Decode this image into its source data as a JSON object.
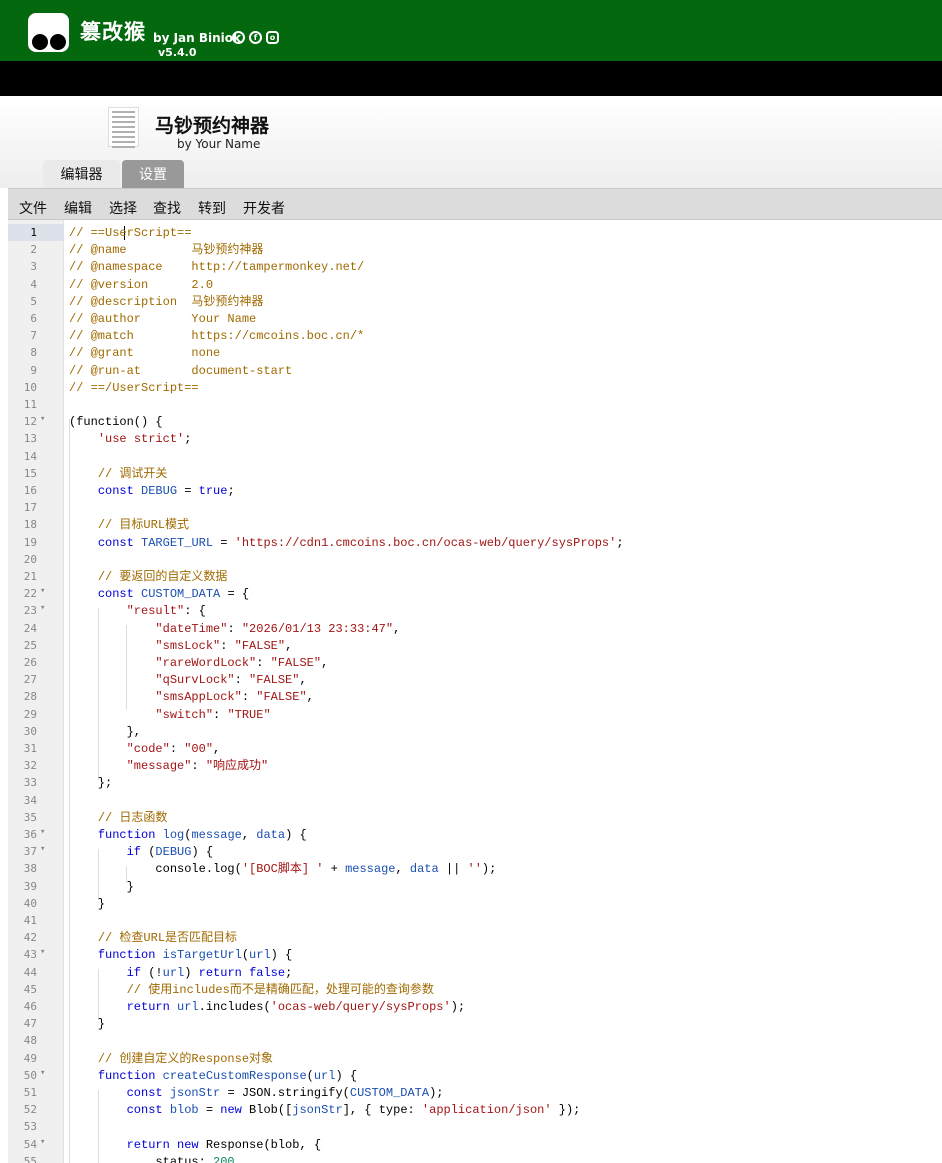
{
  "app": {
    "name": "篡改猴",
    "by": "by Jan Biniok",
    "version": "v5.4.0",
    "social_icons": [
      "github-icon",
      "facebook-icon",
      "instagram-icon"
    ],
    "brand_color": "#04680f"
  },
  "script": {
    "title": "马钞预约神器",
    "author": "by Your Name"
  },
  "tabs": [
    {
      "label": "编辑器",
      "active": true
    },
    {
      "label": "设置",
      "active": false
    }
  ],
  "menu": [
    "文件",
    "编辑",
    "选择",
    "查找",
    "转到",
    "开发者"
  ],
  "editor": {
    "active_line": 1,
    "fold_lines": [
      12,
      22,
      23,
      36,
      37,
      43,
      50,
      54
    ],
    "lines": [
      [
        [
          "c",
          "// ==UserScript=="
        ]
      ],
      [
        [
          "c",
          "// @name         马钞预约神器"
        ]
      ],
      [
        [
          "c",
          "// @namespace    http://tampermonkey.net/"
        ]
      ],
      [
        [
          "c",
          "// @version      2.0"
        ]
      ],
      [
        [
          "c",
          "// @description  马钞预约神器"
        ]
      ],
      [
        [
          "c",
          "// @author       Your Name"
        ]
      ],
      [
        [
          "c",
          "// @match        https://cmcoins.boc.cn/*"
        ]
      ],
      [
        [
          "c",
          "// @grant        none"
        ]
      ],
      [
        [
          "c",
          "// @run-at       document-start"
        ]
      ],
      [
        [
          "c",
          "// ==/UserScript=="
        ]
      ],
      [],
      [
        [
          "",
          "(function() {"
        ]
      ],
      [
        [
          "",
          "    "
        ],
        [
          "s",
          "'use strict'"
        ],
        [
          "",
          ";"
        ]
      ],
      [],
      [
        [
          "",
          "    "
        ],
        [
          "c",
          "// 调试开关"
        ]
      ],
      [
        [
          "",
          "    "
        ],
        [
          "k",
          "const"
        ],
        [
          "",
          " "
        ],
        [
          "v",
          "DEBUG"
        ],
        [
          "",
          " = "
        ],
        [
          "b",
          "true"
        ],
        [
          "",
          ";"
        ]
      ],
      [],
      [
        [
          "",
          "    "
        ],
        [
          "c",
          "// 目标URL模式"
        ]
      ],
      [
        [
          "",
          "    "
        ],
        [
          "k",
          "const"
        ],
        [
          "",
          " "
        ],
        [
          "v",
          "TARGET_URL"
        ],
        [
          "",
          " = "
        ],
        [
          "s",
          "'https://cdn1.cmcoins.boc.cn/ocas-web/query/sysProps'"
        ],
        [
          "",
          ";"
        ]
      ],
      [],
      [
        [
          "",
          "    "
        ],
        [
          "c",
          "// 要返回的自定义数据"
        ]
      ],
      [
        [
          "",
          "    "
        ],
        [
          "k",
          "const"
        ],
        [
          "",
          " "
        ],
        [
          "v",
          "CUSTOM_DATA"
        ],
        [
          "",
          " = {"
        ]
      ],
      [
        [
          "",
          "        "
        ],
        [
          "s",
          "\"result\""
        ],
        [
          "",
          ": {"
        ]
      ],
      [
        [
          "",
          "            "
        ],
        [
          "s",
          "\"dateTime\""
        ],
        [
          "",
          ": "
        ],
        [
          "s",
          "\"2026/01/13 23:33:47\""
        ],
        [
          "",
          ","
        ]
      ],
      [
        [
          "",
          "            "
        ],
        [
          "s",
          "\"smsLock\""
        ],
        [
          "",
          ": "
        ],
        [
          "s",
          "\"FALSE\""
        ],
        [
          "",
          ","
        ]
      ],
      [
        [
          "",
          "            "
        ],
        [
          "s",
          "\"rareWordLock\""
        ],
        [
          "",
          ": "
        ],
        [
          "s",
          "\"FALSE\""
        ],
        [
          "",
          ","
        ]
      ],
      [
        [
          "",
          "            "
        ],
        [
          "s",
          "\"qSurvLock\""
        ],
        [
          "",
          ": "
        ],
        [
          "s",
          "\"FALSE\""
        ],
        [
          "",
          ","
        ]
      ],
      [
        [
          "",
          "            "
        ],
        [
          "s",
          "\"smsAppLock\""
        ],
        [
          "",
          ": "
        ],
        [
          "s",
          "\"FALSE\""
        ],
        [
          "",
          ","
        ]
      ],
      [
        [
          "",
          "            "
        ],
        [
          "s",
          "\"switch\""
        ],
        [
          "",
          ": "
        ],
        [
          "s",
          "\"TRUE\""
        ]
      ],
      [
        [
          "",
          "        },"
        ]
      ],
      [
        [
          "",
          "        "
        ],
        [
          "s",
          "\"code\""
        ],
        [
          "",
          ": "
        ],
        [
          "s",
          "\"00\""
        ],
        [
          "",
          ","
        ]
      ],
      [
        [
          "",
          "        "
        ],
        [
          "s",
          "\"message\""
        ],
        [
          "",
          ": "
        ],
        [
          "s",
          "\"响应成功\""
        ]
      ],
      [
        [
          "",
          "    };"
        ]
      ],
      [],
      [
        [
          "",
          "    "
        ],
        [
          "c",
          "// 日志函数"
        ]
      ],
      [
        [
          "",
          "    "
        ],
        [
          "k",
          "function"
        ],
        [
          "",
          " "
        ],
        [
          "v",
          "log"
        ],
        [
          "",
          "("
        ],
        [
          "v",
          "message"
        ],
        [
          "",
          ", "
        ],
        [
          "v",
          "data"
        ],
        [
          "",
          ") {"
        ]
      ],
      [
        [
          "",
          "        "
        ],
        [
          "k",
          "if"
        ],
        [
          "",
          " ("
        ],
        [
          "v",
          "DEBUG"
        ],
        [
          "",
          ") {"
        ]
      ],
      [
        [
          "",
          "            console.log("
        ],
        [
          "s",
          "'[BOC脚本] '"
        ],
        [
          "",
          " + "
        ],
        [
          "v",
          "message"
        ],
        [
          "",
          ", "
        ],
        [
          "v",
          "data"
        ],
        [
          "",
          " || "
        ],
        [
          "s",
          "''"
        ],
        [
          "",
          ");"
        ]
      ],
      [
        [
          "",
          "        }"
        ]
      ],
      [
        [
          "",
          "    }"
        ]
      ],
      [],
      [
        [
          "",
          "    "
        ],
        [
          "c",
          "// 检查URL是否匹配目标"
        ]
      ],
      [
        [
          "",
          "    "
        ],
        [
          "k",
          "function"
        ],
        [
          "",
          " "
        ],
        [
          "v",
          "isTargetUrl"
        ],
        [
          "",
          "("
        ],
        [
          "v",
          "url"
        ],
        [
          "",
          ") {"
        ]
      ],
      [
        [
          "",
          "        "
        ],
        [
          "k",
          "if"
        ],
        [
          "",
          " (!"
        ],
        [
          "v",
          "url"
        ],
        [
          "",
          ") "
        ],
        [
          "k",
          "return"
        ],
        [
          "",
          " "
        ],
        [
          "b",
          "false"
        ],
        [
          "",
          ";"
        ]
      ],
      [
        [
          "",
          "        "
        ],
        [
          "c",
          "// 使用includes而不是精确匹配，处理可能的查询参数"
        ]
      ],
      [
        [
          "",
          "        "
        ],
        [
          "k",
          "return"
        ],
        [
          "",
          " "
        ],
        [
          "v",
          "url"
        ],
        [
          "",
          ".includes("
        ],
        [
          "s",
          "'ocas-web/query/sysProps'"
        ],
        [
          "",
          ");"
        ]
      ],
      [
        [
          "",
          "    }"
        ]
      ],
      [],
      [
        [
          "",
          "    "
        ],
        [
          "c",
          "// 创建自定义的Response对象"
        ]
      ],
      [
        [
          "",
          "    "
        ],
        [
          "k",
          "function"
        ],
        [
          "",
          " "
        ],
        [
          "v",
          "createCustomResponse"
        ],
        [
          "",
          "("
        ],
        [
          "v",
          "url"
        ],
        [
          "",
          ") {"
        ]
      ],
      [
        [
          "",
          "        "
        ],
        [
          "k",
          "const"
        ],
        [
          "",
          " "
        ],
        [
          "v",
          "jsonStr"
        ],
        [
          "",
          " = JSON.stringify("
        ],
        [
          "v",
          "CUSTOM_DATA"
        ],
        [
          "",
          ");"
        ]
      ],
      [
        [
          "",
          "        "
        ],
        [
          "k",
          "const"
        ],
        [
          "",
          " "
        ],
        [
          "v",
          "blob"
        ],
        [
          "",
          " = "
        ],
        [
          "k",
          "new"
        ],
        [
          "",
          " Blob(["
        ],
        [
          "v",
          "jsonStr"
        ],
        [
          "",
          "], { type: "
        ],
        [
          "s",
          "'application/json'"
        ],
        [
          "",
          " });"
        ]
      ],
      [],
      [
        [
          "",
          "        "
        ],
        [
          "k",
          "return"
        ],
        [
          "",
          " "
        ],
        [
          "k",
          "new"
        ],
        [
          "",
          " Response(blob, {"
        ]
      ],
      [
        [
          "",
          "            status: "
        ],
        [
          "n",
          "200"
        ],
        [
          "",
          ","
        ]
      ]
    ]
  }
}
